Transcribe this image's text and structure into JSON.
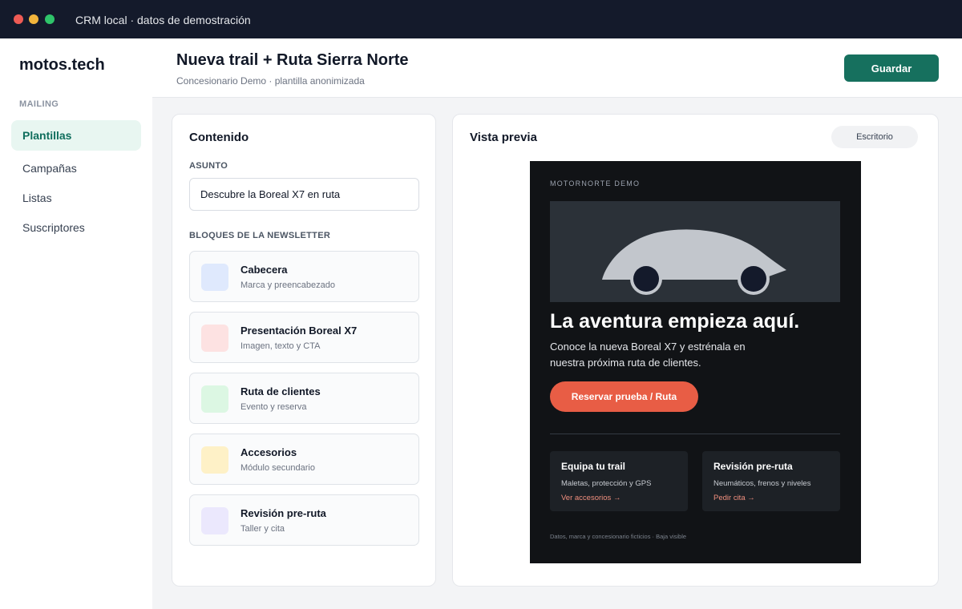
{
  "window": {
    "title": "CRM local · datos de demostración",
    "controls": [
      {
        "name": "close-button",
        "color": "#ee5b55"
      },
      {
        "name": "minimize-button",
        "color": "#f3b53c"
      },
      {
        "name": "maximize-button",
        "color": "#2fc46a"
      }
    ]
  },
  "sidebar": {
    "brand": "motos.tech",
    "section": "MAILING",
    "items": [
      {
        "label": "Plantillas",
        "active": true
      },
      {
        "label": "Campañas",
        "active": false
      },
      {
        "label": "Listas",
        "active": false
      },
      {
        "label": "Suscriptores",
        "active": false
      }
    ]
  },
  "header": {
    "title": "Nueva trail + Ruta Sierra Norte",
    "subtitle": "Concesionario Demo · plantilla anonimizada",
    "save_label": "Guardar"
  },
  "content": {
    "title": "Contenido",
    "subject_label": "ASUNTO",
    "subject_value": "Descubre la Boreal X7 en ruta",
    "blocks_label": "BLOQUES DE LA NEWSLETTER",
    "blocks": [
      {
        "title": "Cabecera",
        "desc": "Marca y preencabezado",
        "color": "#dfe9fd"
      },
      {
        "title": "Presentación Boreal X7",
        "desc": "Imagen, texto y CTA",
        "color": "#fde2e2"
      },
      {
        "title": "Ruta de clientes",
        "desc": "Evento y reserva",
        "color": "#dcf7e3"
      },
      {
        "title": "Accesorios",
        "desc": "Módulo secundario",
        "color": "#fef1c7"
      },
      {
        "title": "Revisión pre-ruta",
        "desc": "Taller y cita",
        "color": "#ebe8fd"
      }
    ]
  },
  "preview": {
    "title": "Vista previa",
    "device": "Escritorio",
    "email": {
      "preheader": "MOTORNORTE DEMO",
      "headline": "La aventura empieza aquí.",
      "body": "Conoce la nueva Boreal X7 y estrénala en nuestra próxima ruta de clientes.",
      "cta": "Reservar prueba / Ruta",
      "modules": [
        {
          "title": "Equipa tu trail",
          "desc": "Maletas, protección y GPS",
          "link": "Ver accesorios →"
        },
        {
          "title": "Revisión pre-ruta",
          "desc": "Neumáticos, frenos y niveles",
          "link": "Pedir cita →"
        }
      ],
      "footer": "Datos, marca y concesionario ficticios · Baja visible"
    }
  },
  "colors": {
    "accent": "#16705e",
    "cta": "#e85d45",
    "email_bg": "#111316"
  }
}
